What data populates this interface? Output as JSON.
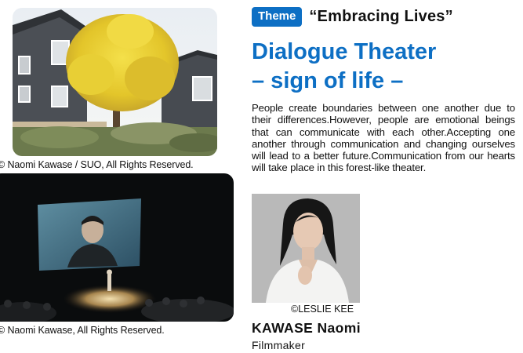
{
  "photos": {
    "building": {
      "caption": "© Naomi Kawase / SUO, All Rights Reserved."
    },
    "theater": {
      "caption": "© Naomi Kawase, All Rights Reserved."
    }
  },
  "theme": {
    "badge": "Theme",
    "title": "“Embracing Lives”"
  },
  "title": {
    "line1": "Dialogue Theater",
    "line2": "– sign of life –"
  },
  "description": "People create boundaries between one another due to their differences.However, people are emotional beings that can communicate with each other.Accepting one another through communication and changing ourselves will lead to a better future.Communication from our hearts will take place in this forest-like theater.",
  "person": {
    "photo_credit": "©LESLIE KEE",
    "name": "KAWASE Naomi",
    "role": "Filmmaker"
  },
  "colors": {
    "accent": "#0d6fc4",
    "text": "#111111"
  }
}
